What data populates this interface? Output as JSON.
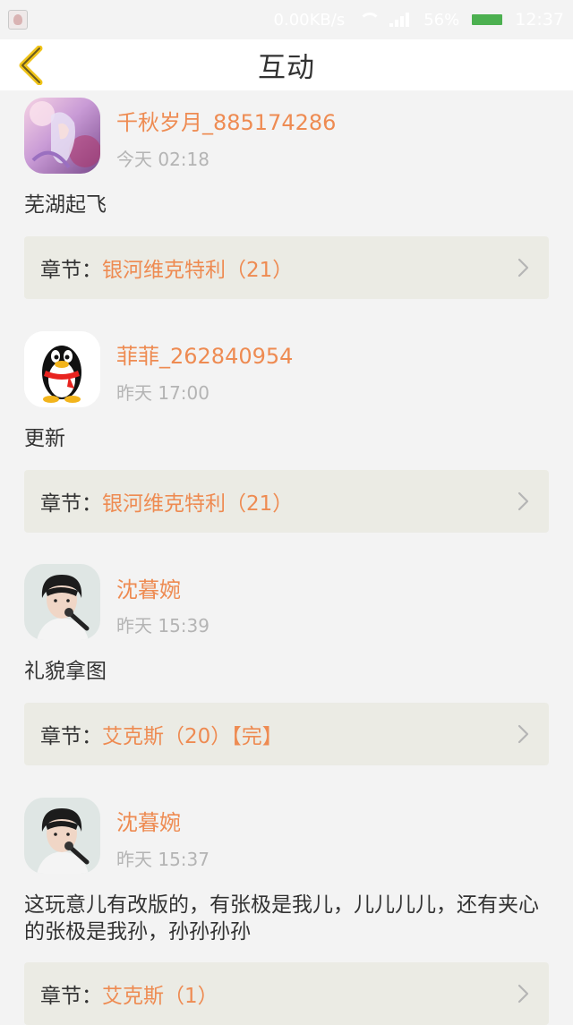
{
  "status_bar": {
    "speed": "0.00KB/s",
    "battery_percent": "56%",
    "time": "12:37",
    "battery_color": "#4cb050"
  },
  "header": {
    "title": "互动",
    "back_icon": "chevron-left-icon",
    "accent_color": "#f0c419"
  },
  "comments": [
    {
      "username": "千秋岁月_885174286",
      "time": "今天 02:18",
      "text": "芜湖起飞",
      "chapter_prefix": "章节：",
      "chapter_name": "银河维克特利（21）",
      "avatar": "anime-girl-avatar"
    },
    {
      "username": "菲菲_262840954",
      "time": "昨天 17:00",
      "text": "更新",
      "chapter_prefix": "章节：",
      "chapter_name": "银河维克特利（21）",
      "avatar": "qq-penguin-avatar"
    },
    {
      "username": "沈暮婉",
      "time": "昨天 15:39",
      "text": "礼貌拿图",
      "chapter_prefix": "章节：",
      "chapter_name": "艾克斯（20）【完】",
      "avatar": "singer-photo-avatar"
    },
    {
      "username": "沈暮婉",
      "time": "昨天 15:37",
      "text": "这玩意儿有改版的，有张极是我儿，儿儿儿儿，还有夹心的张极是我孙，孙孙孙孙",
      "chapter_prefix": "章节：",
      "chapter_name": "艾克斯（1）",
      "avatar": "singer-photo-avatar"
    }
  ]
}
